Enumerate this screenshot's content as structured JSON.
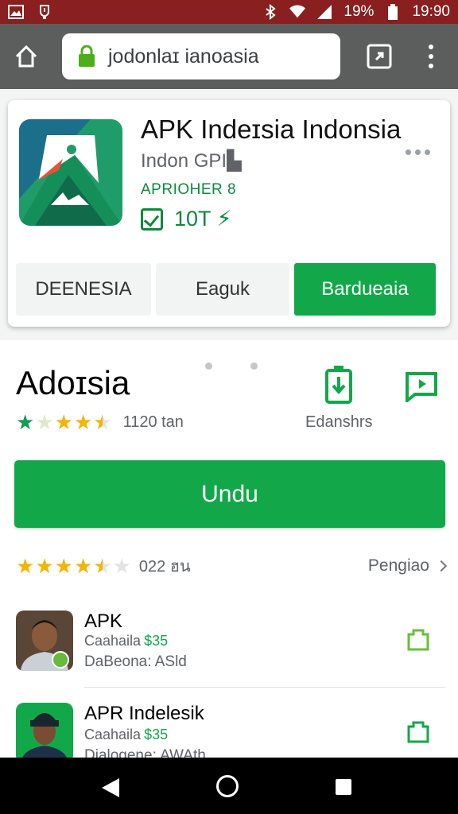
{
  "status_bar": {
    "battery": "19%",
    "time": "19:90",
    "icons": [
      "image-icon",
      "alert-icon",
      "bluetooth-icon",
      "wifi-icon",
      "signal-icon",
      "battery-icon"
    ]
  },
  "browser": {
    "url": "jodonlaɪ ianoasia",
    "icons": [
      "home-icon",
      "lock-icon",
      "tab-switch-icon",
      "overflow-menu-icon"
    ]
  },
  "app_card": {
    "title": "APK Indeɪsia Indonsia",
    "developer": "Indon GPI▙",
    "category": "APRIOHER 8",
    "installs": "10T ⚡",
    "buttons": [
      "DEENESIA",
      "Eaguk",
      "Bardueaia"
    ]
  },
  "detail": {
    "title": "Adoɪsia",
    "rating": 3.5,
    "rating_count": "1120 tan",
    "side_label": "Edanshrs",
    "install_label": "Undu",
    "review_rating": 4.5,
    "review_count": "022 ฮน",
    "see_more": "Pengiao"
  },
  "list": {
    "items": [
      {
        "name": "APK",
        "line2": "Caahaila",
        "price": "$35",
        "line3": "DaBeona: ASld"
      },
      {
        "name": "APR Indelesik",
        "line2": "Caahaila",
        "price": "$35",
        "line3": "Dialogene: AWAth"
      }
    ]
  },
  "colors": {
    "status_bar": "#8a1f1f",
    "browser_bar": "#5b5e5d",
    "accent_green": "#12a84a",
    "star_gold": "#f4b400",
    "star_green": "#0f9d58"
  }
}
